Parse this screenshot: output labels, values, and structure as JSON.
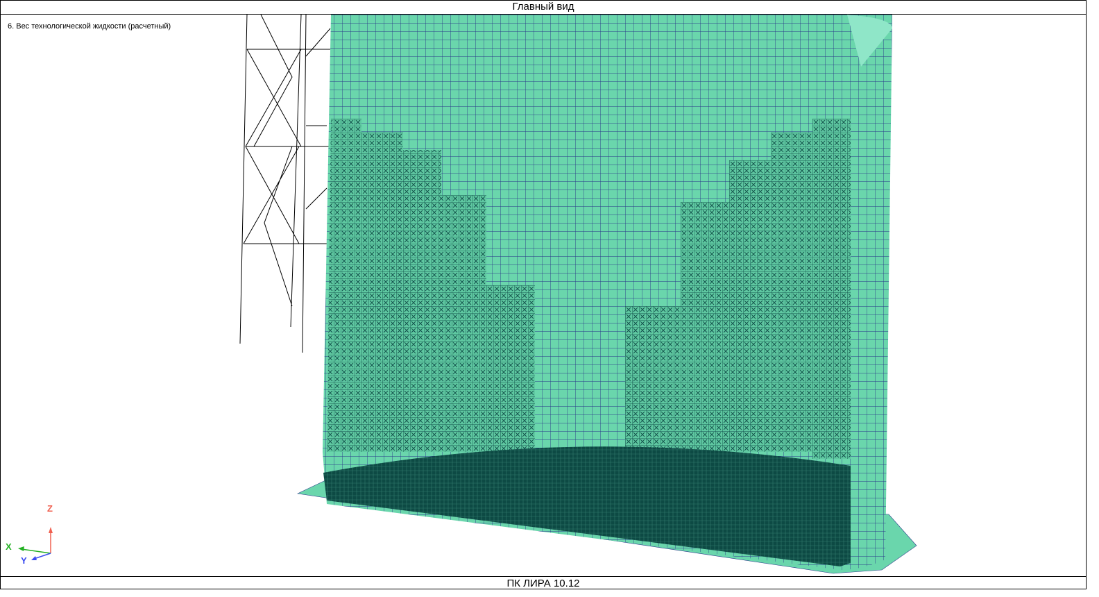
{
  "window": {
    "title": "Главный вид",
    "footer": "ПК ЛИРА 10.12"
  },
  "viewport": {
    "load_case": "6. Вес технологической жидкости (расчетный)"
  },
  "axes": {
    "x": "X",
    "y": "Y",
    "z": "Z",
    "x_color": "#22b022",
    "y_color": "#3a4cf0",
    "z_color": "#f06050"
  },
  "colors": {
    "shell": "#6ad6ac",
    "mesh": "#2a3a8a",
    "loads": "#0d4a44"
  }
}
